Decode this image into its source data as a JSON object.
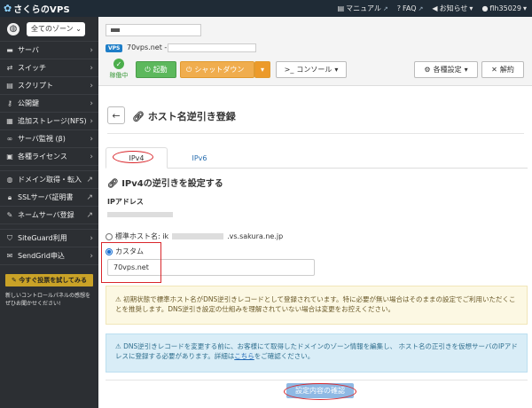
{
  "topbar": {
    "logo": "さくらのVPS",
    "manual": "マニュアル",
    "faq": "FAQ",
    "news": "お知らせ",
    "user": "flh35029"
  },
  "sidebar": {
    "zone": "全てのゾーン",
    "items": [
      {
        "icon": "server-icon",
        "label": "サーバ"
      },
      {
        "icon": "switch-icon",
        "label": "スイッチ"
      },
      {
        "icon": "script-icon",
        "label": "スクリプト"
      },
      {
        "icon": "key-icon",
        "label": "公開鍵"
      },
      {
        "icon": "storage-icon",
        "label": "追加ストレージ(NFS)"
      },
      {
        "icon": "binoculars-icon",
        "label": "サーバ監視 (β)"
      },
      {
        "icon": "license-icon",
        "label": "各種ライセンス"
      },
      {
        "icon": "globe-icon",
        "label": "ドメイン取得・転入"
      },
      {
        "icon": "lock-icon",
        "label": "SSLサーバ証明書"
      },
      {
        "icon": "edit-icon",
        "label": "ネームサーバ登録"
      },
      {
        "icon": "shield-icon",
        "label": "SiteGuard利用"
      },
      {
        "icon": "mail-icon",
        "label": "SendGrid申込"
      }
    ],
    "try_button": "今すぐ投票を試してみる",
    "feedback": "新しいコントロールパネルの感想をぜひお聞かせください!"
  },
  "server": {
    "badge": "VPS",
    "host": "70vps.net -",
    "status": "稼働中",
    "start": "起動",
    "shutdown": "シャットダウン",
    "console": "コンソール",
    "settings": "各種設定",
    "cancel": "解約"
  },
  "main": {
    "title": "ホスト名逆引き登録",
    "tabs": [
      "IPv4",
      "IPv6"
    ],
    "section_title": "IPv4の逆引きを設定する",
    "ip_label": "IPアドレス",
    "standard_prefix": "標準ホスト名: ik",
    "standard_suffix": ".vs.sakura.ne.jp",
    "custom_label": "カスタム",
    "custom_value": "70vps.net",
    "warning": "初期状態で標準ホスト名がDNS逆引きレコードとして登録されています。特に必要が無い場合はそのままの設定でご利用いただくことを推奨します。DNS逆引き設定の仕組みを理解されていない場合は変更をお控えください。",
    "info_before": "DNS逆引きレコードを変更する前に、お客様にて取得したドメインのゾーン情報を編集し、 ホスト名の正引きを仮想サーバのIPアドレスに登録する必要があります。詳細は",
    "info_link": "こちら",
    "info_after": "をご確認ください。",
    "confirm": "設定内容の確認"
  }
}
